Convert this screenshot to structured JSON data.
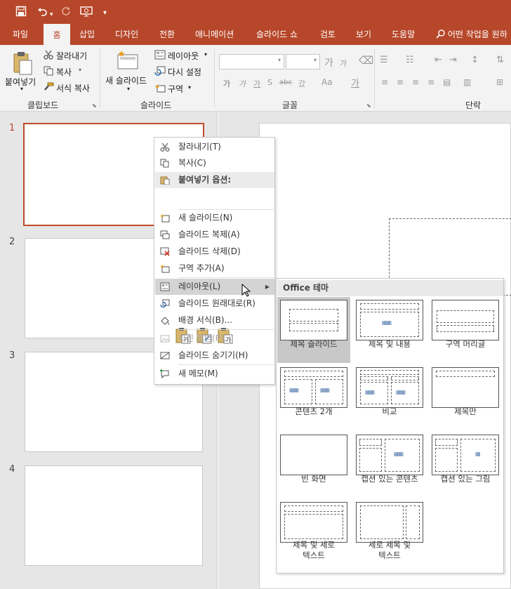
{
  "quick_access": {
    "save": "save-icon",
    "undo": "undo-icon",
    "redo": "redo-icon",
    "present": "present-icon",
    "customize": "▾"
  },
  "tabs": [
    {
      "label": "파일",
      "active": false
    },
    {
      "label": "홈",
      "active": true
    },
    {
      "label": "삽입",
      "active": false
    },
    {
      "label": "디자인",
      "active": false
    },
    {
      "label": "전환",
      "active": false
    },
    {
      "label": "애니메이션",
      "active": false
    },
    {
      "label": "슬라이드 쇼",
      "active": false
    },
    {
      "label": "검토",
      "active": false
    },
    {
      "label": "보기",
      "active": false
    },
    {
      "label": "도움말",
      "active": false
    }
  ],
  "tell_me": "어떤 작업을 원하",
  "ribbon": {
    "clipboard": {
      "paste": "붙여넣기",
      "cut": "잘라내기",
      "copy": "복사",
      "format_painter": "서식 복사",
      "group_label": "클립보드"
    },
    "slides": {
      "new_slide": "새 슬라이드",
      "layout": "레이아웃",
      "reset": "다시 설정",
      "section": "구역",
      "group_label": "슬라이드"
    },
    "font": {
      "grow": "가",
      "shrink": "가",
      "bold": "가",
      "italic": "가",
      "underline": "가",
      "strike": "abc",
      "spacing": "갔",
      "case": "Aa",
      "color": "가",
      "group_label": "글꼴"
    },
    "paragraph": {
      "group_label": "단락"
    }
  },
  "slide_numbers": [
    "1",
    "2",
    "3",
    "4"
  ],
  "context_menu": {
    "items": [
      {
        "label": "잘라내기(T)",
        "icon": "scissors-icon"
      },
      {
        "label": "복사(C)",
        "icon": "copy-icon"
      },
      {
        "label": "붙여넣기 옵션:",
        "icon": "paste-icon"
      },
      {
        "label": "새 슬라이드(N)",
        "icon": "new-slide-icon"
      },
      {
        "label": "슬라이드 복제(A)",
        "icon": "duplicate-slide-icon"
      },
      {
        "label": "슬라이드 삭제(D)",
        "icon": "delete-slide-icon"
      },
      {
        "label": "구역 추가(A)",
        "icon": "add-section-icon"
      },
      {
        "label": "레이아웃(L)",
        "icon": "layout-icon"
      },
      {
        "label": "슬라이드 원래대로(R)",
        "icon": "reset-slide-icon"
      },
      {
        "label": "배경 서식(B)...",
        "icon": "format-background-icon"
      },
      {
        "label": "사진 앨범(P)...",
        "icon": "photo-album-icon"
      },
      {
        "label": "슬라이드 숨기기(H)",
        "icon": "hide-slide-icon"
      },
      {
        "label": "새 메모(M)",
        "icon": "new-comment-icon"
      }
    ],
    "paste_option_glyph": "가"
  },
  "layout_submenu": {
    "title": "Office 테마",
    "layouts": [
      {
        "label": "제목 슬라이드",
        "selected": true
      },
      {
        "label": "제목 및 내용",
        "selected": false
      },
      {
        "label": "구역 머리글",
        "selected": false
      },
      {
        "label": "콘텐츠 2개",
        "selected": false
      },
      {
        "label": "비교",
        "selected": false
      },
      {
        "label": "제목만",
        "selected": false
      },
      {
        "label": "빈 화면",
        "selected": false
      },
      {
        "label": "캡션 있는 콘텐츠",
        "selected": false
      },
      {
        "label": "캡션 있는 그림",
        "selected": false
      },
      {
        "label": "제목 및 세로\n텍스트",
        "selected": false
      },
      {
        "label": "세로 제목 및\n텍스트",
        "selected": false
      }
    ]
  }
}
